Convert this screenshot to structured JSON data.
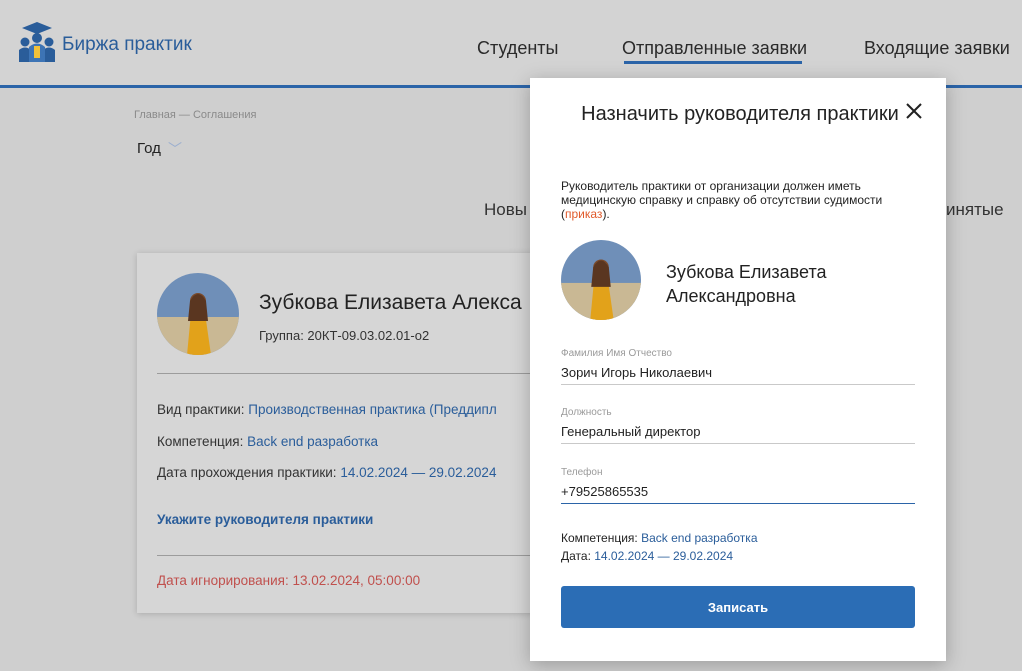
{
  "header": {
    "brand": "Биржа практик",
    "nav": [
      "Студенты",
      "Отправленные заявки",
      "Входящие заявки"
    ]
  },
  "breadcrumb": "Главная — Соглашения",
  "filter": {
    "year_label": "Год"
  },
  "tabs_visible": {
    "left_fragment": "Новы",
    "right_fragment": "инятые"
  },
  "card": {
    "student_name": "Зубкова Елизавета Алекса",
    "group": "Группа: 20КТ-09.03.02.01-о2",
    "practice_type_label": "Вид практики: ",
    "practice_type_value": "Производственная практика (Преддипл",
    "competence_label": "Компетенция: ",
    "competence_value": "Back end разработка",
    "dates_label": "Дата прохождения практики: ",
    "dates_value": "14.02.2024 — 29.02.2024",
    "assign_link": "Укажите руководителя практики",
    "ignore_date": "Дата игнорирования: 13.02.2024, 05:00:00"
  },
  "modal": {
    "title": "Назначить руководителя практики",
    "note_text": "Руководитель практики от организации должен иметь медицинскую справку и справку об отсутствии судимости (",
    "note_link": "приказ",
    "note_end": ").",
    "student_name": "Зубкова Елизавета Александровна",
    "fields": [
      {
        "label": "Фамилия Имя Отчество",
        "value": "Зорич Игорь Николаевич"
      },
      {
        "label": "Должность",
        "value": "Генеральный директор"
      },
      {
        "label": "Телефон",
        "value": "+79525865535"
      }
    ],
    "competence_label": "Компетенция: ",
    "competence_value": "Back end разработка",
    "date_label": "Дата: ",
    "date_value": "14.02.2024 — 29.02.2024",
    "submit_label": "Записать"
  },
  "colors": {
    "accent": "#2b6db5",
    "link": "#2a5d9a",
    "warning": "#c0504d",
    "order_link": "#e05a2b"
  },
  "icons": [
    "graduates-logo-icon",
    "chevron-down-icon",
    "close-icon"
  ]
}
